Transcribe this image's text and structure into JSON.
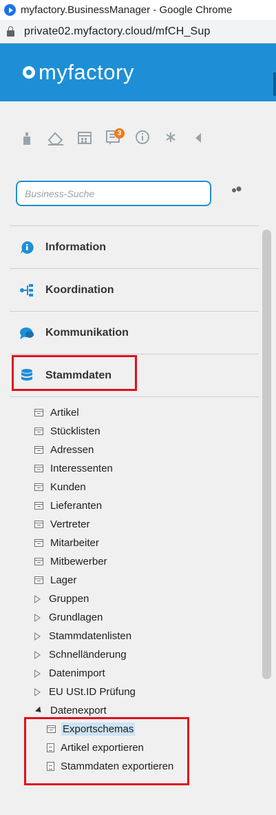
{
  "browser": {
    "title": "myfactory.BusinessManager - Google Chrome",
    "url": "private02.myfactory.cloud/mfCH_Sup"
  },
  "header": {
    "logo": "myfactory"
  },
  "toolbar": {
    "icons": [
      "user-icon",
      "eraser-icon",
      "calendar-icon",
      "tasks-icon",
      "info-icon",
      "asterisk-icon",
      "collapse-icon"
    ],
    "tasks_badge": "3"
  },
  "search": {
    "placeholder": "Business-Suche",
    "value": ""
  },
  "nav": {
    "items": [
      {
        "label": "Information",
        "icon": "info-icon"
      },
      {
        "label": "Koordination",
        "icon": "workflow-icon"
      },
      {
        "label": "Kommunikation",
        "icon": "chat-icon"
      },
      {
        "label": "Stammdaten",
        "icon": "database-icon"
      }
    ]
  },
  "tree": {
    "items": [
      {
        "label": "Artikel",
        "type": "table"
      },
      {
        "label": "Stücklisten",
        "type": "table"
      },
      {
        "label": "Adressen",
        "type": "table"
      },
      {
        "label": "Interessenten",
        "type": "table"
      },
      {
        "label": "Kunden",
        "type": "table"
      },
      {
        "label": "Lieferanten",
        "type": "table"
      },
      {
        "label": "Vertreter",
        "type": "table"
      },
      {
        "label": "Mitarbeiter",
        "type": "table"
      },
      {
        "label": "Mitbewerber",
        "type": "table"
      },
      {
        "label": "Lager",
        "type": "table"
      },
      {
        "label": "Gruppen",
        "type": "folder-collapsed"
      },
      {
        "label": "Grundlagen",
        "type": "folder-collapsed"
      },
      {
        "label": "Stammdatenlisten",
        "type": "folder-collapsed"
      },
      {
        "label": "Schnelländerung",
        "type": "folder-collapsed"
      },
      {
        "label": "Datenimport",
        "type": "folder-collapsed"
      },
      {
        "label": "EU USt.ID Prüfung",
        "type": "folder-collapsed"
      },
      {
        "label": "Datenexport",
        "type": "folder-expanded"
      },
      {
        "label": "Exportschemas",
        "type": "table-child",
        "selected": true
      },
      {
        "label": "Artikel exportieren",
        "type": "doc-child"
      },
      {
        "label": "Stammdaten exportieren",
        "type": "doc-child"
      }
    ]
  },
  "colors": {
    "brand": "#1e8fd6",
    "highlight": "#e0101a",
    "selection": "#cde3f5",
    "badge": "#f07b18"
  }
}
